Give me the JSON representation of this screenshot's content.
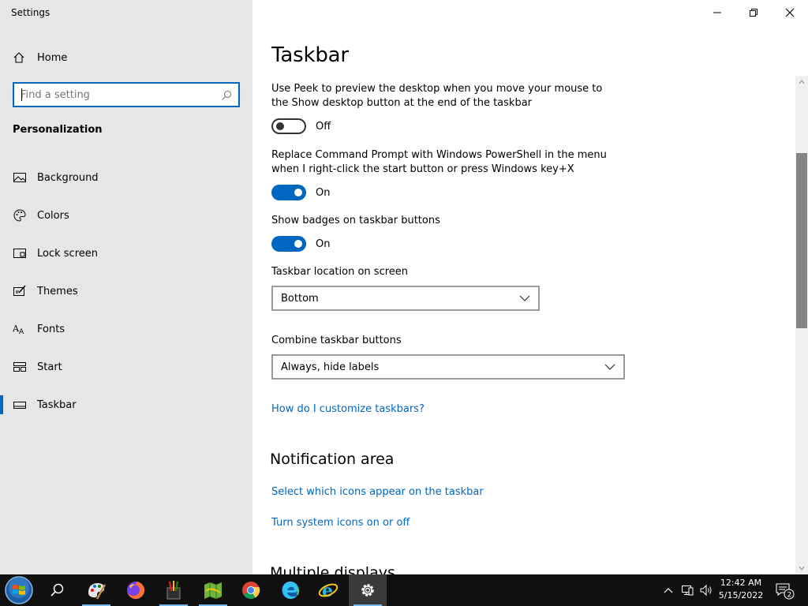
{
  "window": {
    "title": "Settings"
  },
  "sidebar": {
    "home_label": "Home",
    "search_placeholder": "Find a setting",
    "section_title": "Personalization",
    "items": [
      {
        "label": "Background",
        "icon": "picture-icon"
      },
      {
        "label": "Colors",
        "icon": "palette-icon"
      },
      {
        "label": "Lock screen",
        "icon": "lock-screen-icon"
      },
      {
        "label": "Themes",
        "icon": "themes-icon"
      },
      {
        "label": "Fonts",
        "icon": "fonts-icon"
      },
      {
        "label": "Start",
        "icon": "start-icon"
      },
      {
        "label": "Taskbar",
        "icon": "taskbar-icon",
        "active": true
      }
    ]
  },
  "main": {
    "title": "Taskbar",
    "peek": {
      "description": "Use Peek to preview the desktop when you move your mouse to the Show desktop button at the end of the taskbar",
      "state": "Off"
    },
    "powershell": {
      "description": "Replace Command Prompt with Windows PowerShell in the menu when I right-click the start button or press Windows key+X",
      "state": "On"
    },
    "badges": {
      "description": "Show badges on taskbar buttons",
      "state": "On"
    },
    "location": {
      "label": "Taskbar location on screen",
      "value": "Bottom"
    },
    "combine": {
      "label": "Combine taskbar buttons",
      "value": "Always, hide labels"
    },
    "customize_link": "How do I customize taskbars?",
    "notification_area": {
      "title": "Notification area",
      "link1": "Select which icons appear on the taskbar",
      "link2": "Turn system icons on or off"
    },
    "multiple_displays_title": "Multiple displays"
  },
  "taskbar": {
    "apps": [
      "start-orb-icon",
      "search-icon",
      "paint-icon",
      "firefox-icon",
      "office-icon",
      "maps-icon",
      "chrome-icon",
      "edge-icon",
      "internet-explorer-icon",
      "settings-gear-icon"
    ],
    "time": "12:42 AM",
    "date": "5/15/2022",
    "notification_count": "2"
  },
  "colors": {
    "accent": "#0067c0",
    "sidebar_bg": "#e6e6e6",
    "taskbar_bg": "#101010"
  }
}
